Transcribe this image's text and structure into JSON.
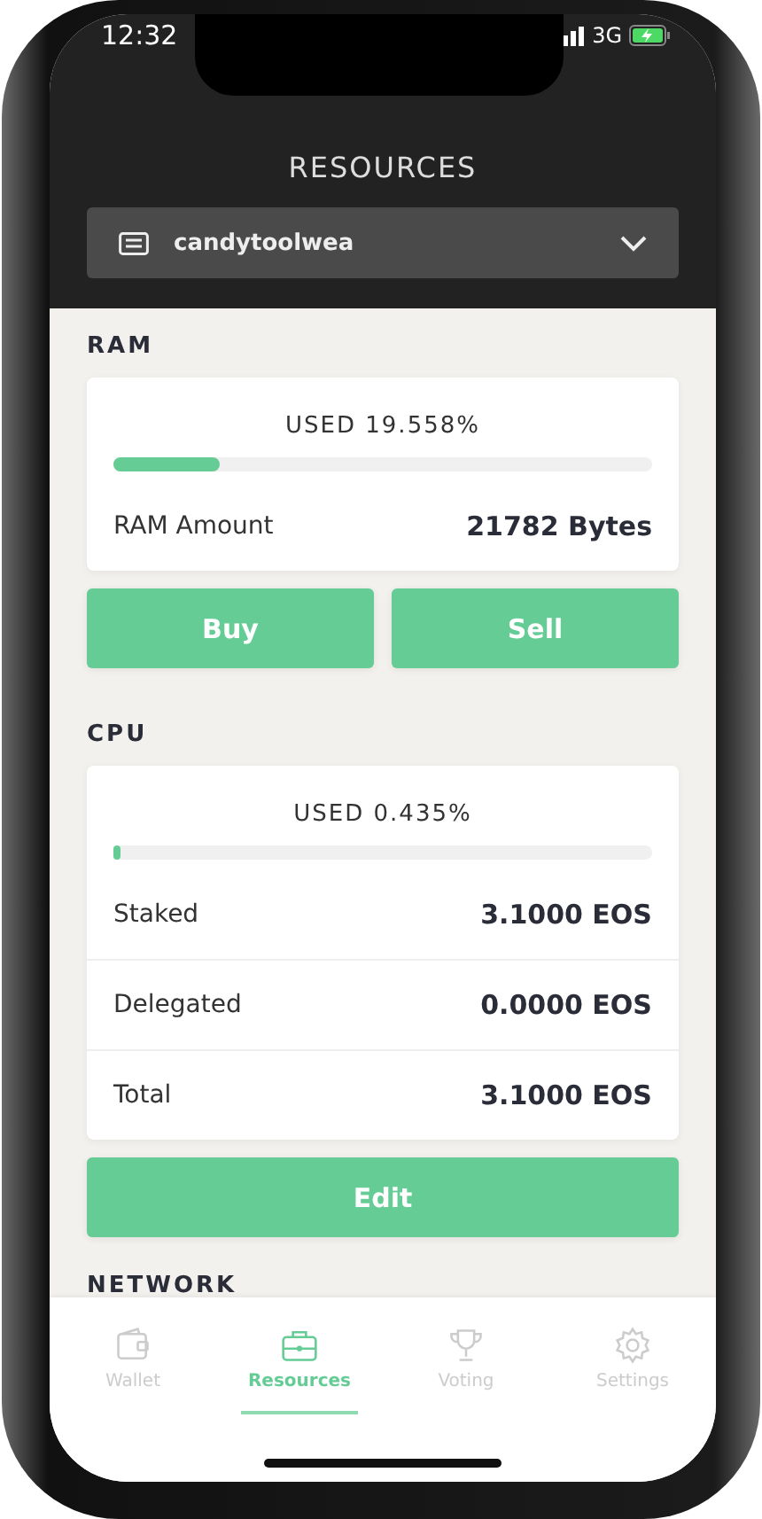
{
  "status_bar": {
    "time": "12:32",
    "network": "3G"
  },
  "header": {
    "title": "RESOURCES",
    "account": "candytoolwea"
  },
  "sections": [
    {
      "title": "RAM",
      "usage": {
        "label": "USED 19.558%",
        "level": 0.196
      },
      "rows": [
        {
          "label": "RAM Amount",
          "value": "21782 Bytes"
        }
      ],
      "buttons": [
        "Buy",
        "Sell"
      ]
    },
    {
      "title": "CPU",
      "usage": {
        "label": "USED 0.435%",
        "level": 0.004
      },
      "rows": [
        {
          "label": "Staked",
          "value": "3.1000 EOS"
        },
        {
          "label": "Delegated",
          "value": "0.0000 EOS"
        },
        {
          "label": "Total",
          "value": "3.1000 EOS"
        }
      ],
      "buttons": [
        "Edit"
      ]
    },
    {
      "title": "NETWORK"
    }
  ],
  "tabs": [
    {
      "label": "Wallet",
      "selected": false
    },
    {
      "label": "Resources",
      "selected": true
    },
    {
      "label": "Voting",
      "selected": false
    },
    {
      "label": "Settings",
      "selected": false
    }
  ]
}
